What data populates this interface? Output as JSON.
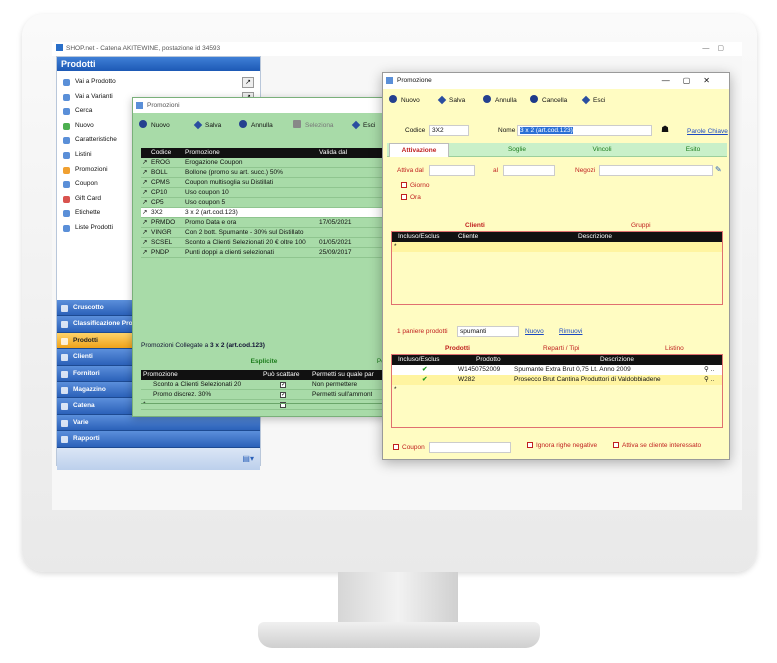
{
  "app": {
    "title": "SHOP.net - Catena AKITEWINE, postazione id 34593"
  },
  "nav": {
    "header": "Prodotti",
    "items": [
      {
        "label": "Vai a Prodotto",
        "icon": "magnifier-icon"
      },
      {
        "label": "Vai a Varianti",
        "icon": "magnifier-icon"
      },
      {
        "label": "Cerca",
        "icon": "search-icon"
      },
      {
        "label": "Nuovo",
        "icon": "new-icon"
      },
      {
        "label": "Caratteristiche",
        "icon": "list-icon"
      },
      {
        "label": "Listini",
        "icon": "price-list-icon"
      },
      {
        "label": "Promozioni",
        "icon": "promotion-icon"
      },
      {
        "label": "Coupon",
        "icon": "coupon-icon"
      },
      {
        "label": "Gift Card",
        "icon": "gift-card-icon"
      },
      {
        "label": "Etichette",
        "icon": "label-icon"
      },
      {
        "label": "Liste Prodotti",
        "icon": "list-icon"
      }
    ],
    "categories": [
      {
        "label": "Cruscotto"
      },
      {
        "label": "Classificazione Prodotti"
      },
      {
        "label": "Prodotti"
      },
      {
        "label": "Clienti"
      },
      {
        "label": "Fornitori"
      },
      {
        "label": "Magazzino"
      },
      {
        "label": "Catena"
      },
      {
        "label": "Varie"
      },
      {
        "label": "Rapporti"
      }
    ]
  },
  "promo_list": {
    "title": "Promozioni",
    "toolbar": {
      "nuovo": "Nuovo",
      "salva": "Salva",
      "annulla": "Annulla",
      "seleziona": "Seleziona",
      "esci": "Esci"
    },
    "columns": {
      "codice": "Codice",
      "promozione": "Promozione",
      "valida_dal": "Valida dal"
    },
    "rows": [
      {
        "codice": "EROG",
        "promozione": "Erogazione Coupon",
        "dal": ""
      },
      {
        "codice": "BOLL",
        "promozione": "Bollone (promo su art. succ.) 50%",
        "dal": ""
      },
      {
        "codice": "CPMS",
        "promozione": "Coupon multisoglia su Distillati",
        "dal": ""
      },
      {
        "codice": "CP10",
        "promozione": "Uso coupon 10",
        "dal": ""
      },
      {
        "codice": "CP5",
        "promozione": "Uso coupon 5",
        "dal": ""
      },
      {
        "codice": "3X2",
        "promozione": "3 x 2 (art.cod.123)",
        "dal": ""
      },
      {
        "codice": "PRMDO",
        "promozione": "Promo Data e ora",
        "dal": "17/05/2021"
      },
      {
        "codice": "VINGR",
        "promozione": "Con 2 bott. Spumante - 30% sul Distillato",
        "dal": ""
      },
      {
        "codice": "SCSEL",
        "promozione": "Sconto a Clienti Selezionati 20 € oltre 100",
        "dal": "01/05/2021"
      },
      {
        "codice": "PNDP",
        "promozione": "Punti doppi a clienti selezionati",
        "dal": "25/09/2017"
      }
    ],
    "collegate_prefix": "Promozioni Collegate a",
    "collegate_name": "3 x 2 (art.cod.123)",
    "esplicite": "Esplicite",
    "per": "Per",
    "links_columns": {
      "promozione": "Promozione",
      "puo": "Può scattare",
      "permetti": "Permetti su quale par"
    },
    "links": [
      {
        "promozione": "Sconto a Clienti Selezionati 20",
        "permetti": "Non permettere"
      },
      {
        "promozione": "Promo discrez. 30%",
        "permetti": "Permetti sull'ammont"
      }
    ]
  },
  "promo_detail": {
    "title": "Promozione",
    "toolbar": {
      "nuovo": "Nuovo",
      "salva": "Salva",
      "annulla": "Annulla",
      "cancella": "Cancella",
      "esci": "Esci"
    },
    "codice_label": "Codice",
    "codice_value": "3X2",
    "nome_label": "Nome",
    "nome_value": "3 x 2 (art.cod.123)",
    "parole_chiave": "Parole Chiave",
    "tabs": [
      "Attivazione",
      "Soglie",
      "Vincoli",
      "Esito"
    ],
    "attiva_dal": "Attiva dal",
    "al": "al",
    "negozi": "Negozi",
    "giorno": "Giorno",
    "ora": "Ora",
    "clienti": "Clienti",
    "gruppi": "Gruppi",
    "clienti_cols": {
      "incluso": "Incluso/Esclus",
      "cliente": "Cliente",
      "descrizione": "Descrizione"
    },
    "paniere_label": "1 paniere prodotti",
    "paniere_value": "spumanti",
    "nuovo_link": "Nuovo",
    "rimuovi_link": "Rimuovi",
    "prodotti": "Prodotti",
    "reparti": "Reparti / Tipi",
    "listino": "Listino",
    "prod_cols": {
      "incluso": "Incluso/Esclus",
      "prodotto": "Prodotto",
      "descrizione": "Descrizione"
    },
    "products": [
      {
        "codice": "W1450752009",
        "descrizione": "Spumante Extra Brut  0,75 Lt. Anno 2009"
      },
      {
        "codice": "W282",
        "descrizione": "Prosecco Brut Cantina Produttori di Valdobbiadene"
      }
    ],
    "coupon": "Coupon",
    "ignora": "Ignora righe negative",
    "attiva_se": "Attiva se cliente interessato"
  }
}
